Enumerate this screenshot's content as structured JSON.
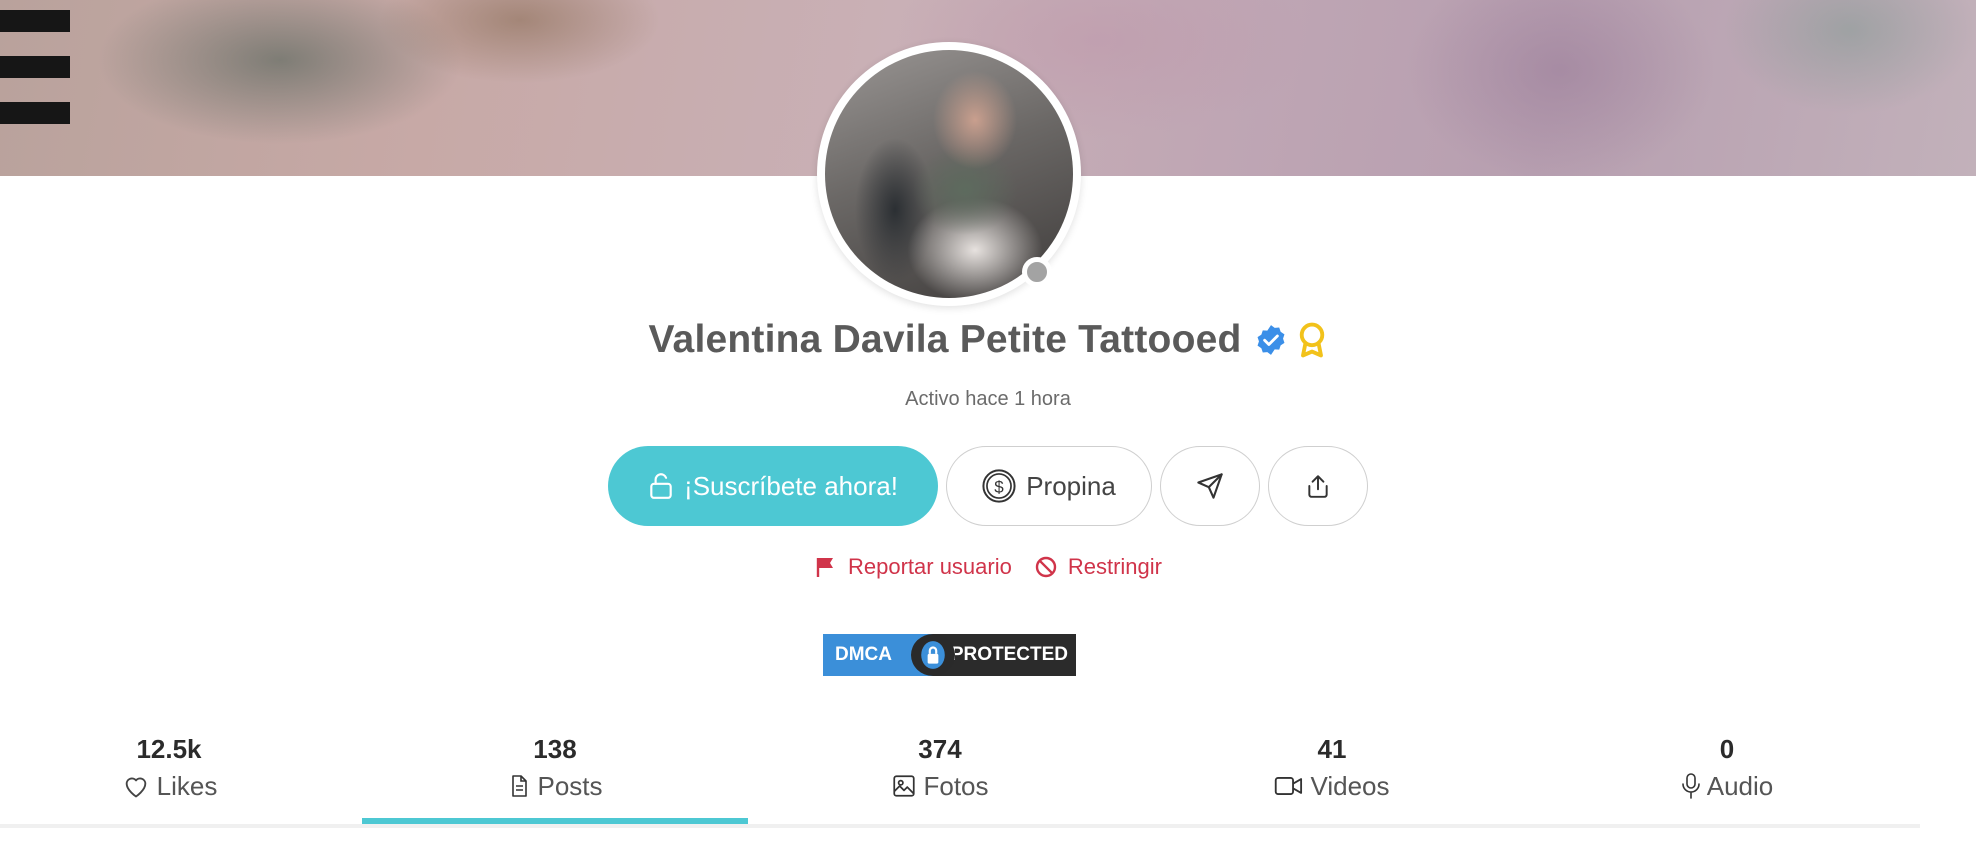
{
  "profile": {
    "name": "Valentina Davila Petite Tattooed",
    "status": "Activo hace 1 hora"
  },
  "buttons": {
    "subscribe_label": "¡Suscríbete ahora!",
    "tip_label": "Propina"
  },
  "actions": {
    "report_label": "Reportar usuario",
    "restrict_label": "Restringir"
  },
  "dmca": {
    "left": "DMCA",
    "right": "PROTECTED"
  },
  "stats": [
    {
      "count": "12.5k",
      "label": "Likes",
      "icon": "heart-icon"
    },
    {
      "count": "138",
      "label": "Posts",
      "icon": "document-icon",
      "active": true
    },
    {
      "count": "374",
      "label": "Fotos",
      "icon": "image-icon"
    },
    {
      "count": "41",
      "label": "Videos",
      "icon": "video-icon"
    },
    {
      "count": "0",
      "label": "Audio",
      "icon": "microphone-icon"
    }
  ],
  "colors": {
    "accent": "#4dc8d3",
    "danger": "#d0344a",
    "verified": "#3b8fe8",
    "award": "#f2c21b",
    "offline_dot": "#a3a3a3"
  }
}
